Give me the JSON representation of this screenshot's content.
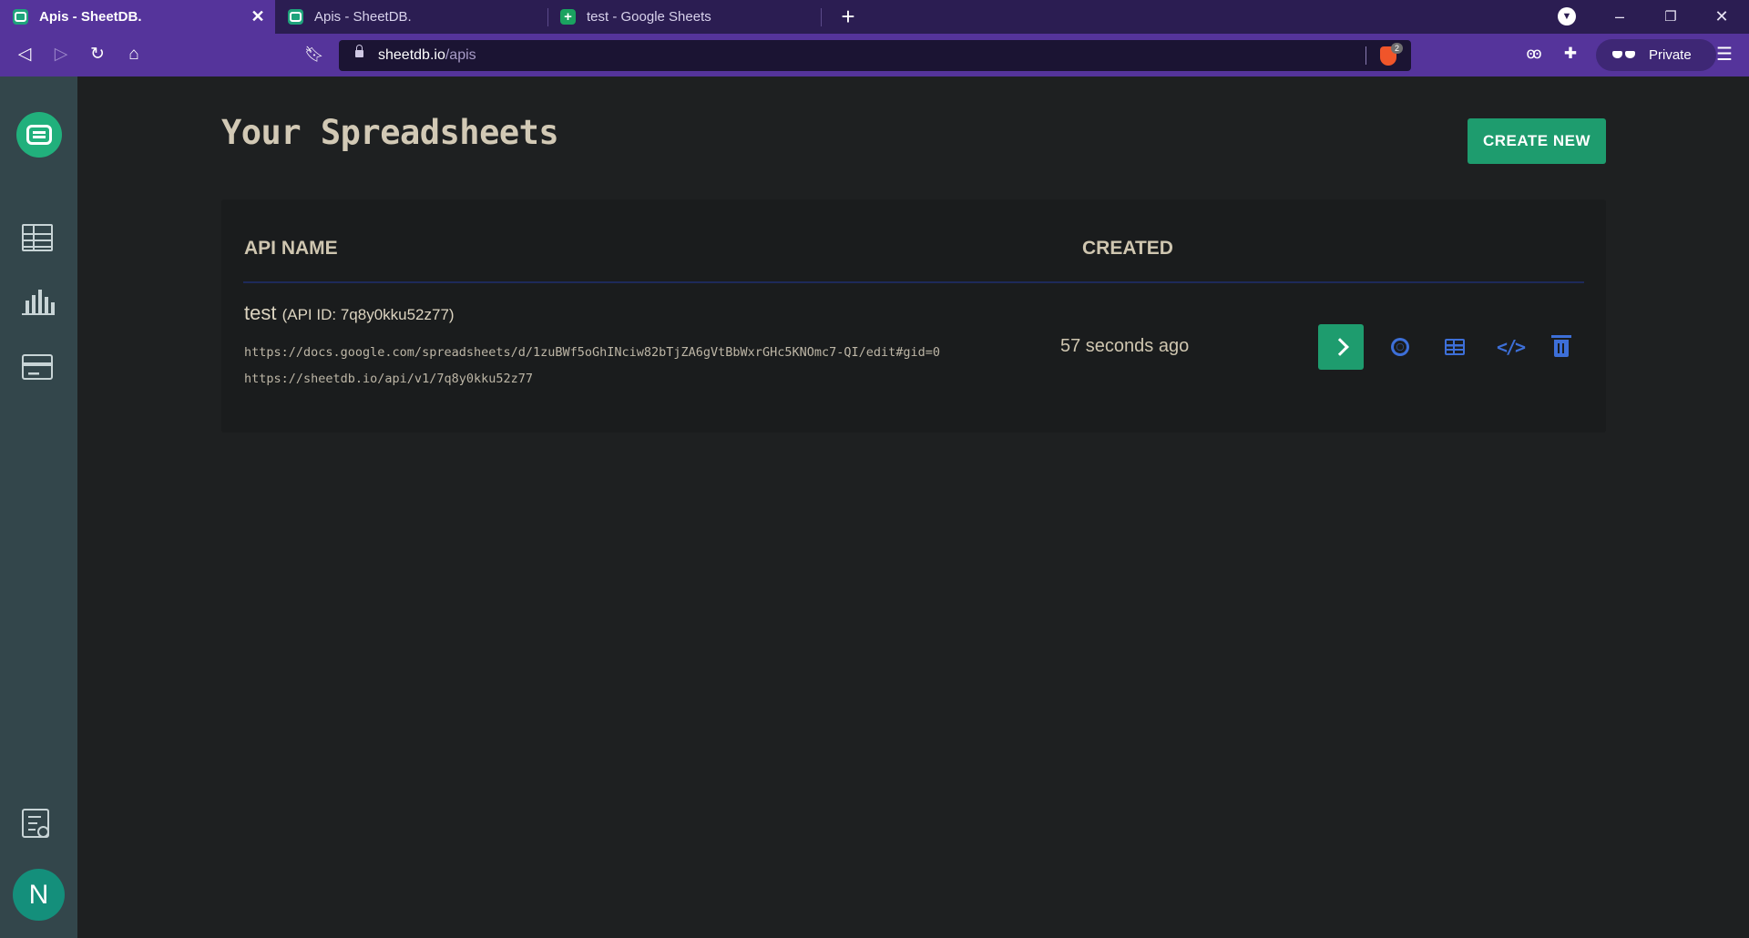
{
  "browser": {
    "tabs": [
      {
        "title": "Apis - SheetDB.",
        "active": true,
        "icon": "sheetdb-icon"
      },
      {
        "title": "Apis - SheetDB.",
        "active": false,
        "icon": "sheetdb-icon"
      },
      {
        "title": "test - Google Sheets",
        "active": false,
        "icon": "google-sheets-icon"
      }
    ],
    "close_glyph": "✕",
    "new_tab_glyph": "+",
    "url_host": "sheetdb.io",
    "url_path": "/apis",
    "brave_shield_count": "2",
    "private_label": "Private",
    "window_controls": {
      "minimize": "–",
      "restore": "❐",
      "close": "✕"
    }
  },
  "sidebar": {
    "items": [
      {
        "name": "logo",
        "icon": "sheetdb-logo-icon"
      },
      {
        "name": "spreadsheets",
        "icon": "table-icon"
      },
      {
        "name": "statistics",
        "icon": "bar-chart-icon"
      },
      {
        "name": "billing",
        "icon": "credit-card-icon"
      },
      {
        "name": "docs",
        "icon": "document-search-icon"
      }
    ],
    "avatar_letter": "N"
  },
  "main": {
    "title": "Your Spreadsheets",
    "create_button": "CREATE NEW",
    "table": {
      "columns": [
        "API NAME",
        "CREATED"
      ],
      "rows": [
        {
          "name": "test",
          "api_id_label": "(API ID: 7q8y0kku52z77)",
          "spreadsheet_url": "https://docs.google.com/spreadsheets/d/1zuBWf5oGhINciw82bTjZA6gVtBbWxrGHc5KNOmc7-QI/edit#gid=0",
          "api_url": "https://sheetdb.io/api/v1/7q8y0kku52z77",
          "created": "57 seconds ago",
          "actions": [
            "open-icon",
            "settings-gear-icon",
            "table-view-icon",
            "code-icon",
            "trash-icon"
          ]
        }
      ]
    }
  },
  "colors": {
    "accent": "#1e9c6e",
    "action_icons": "#3d6fd8",
    "background": "#1e2021",
    "sidebar": "#33464b",
    "browser_frame": "#55349b"
  }
}
